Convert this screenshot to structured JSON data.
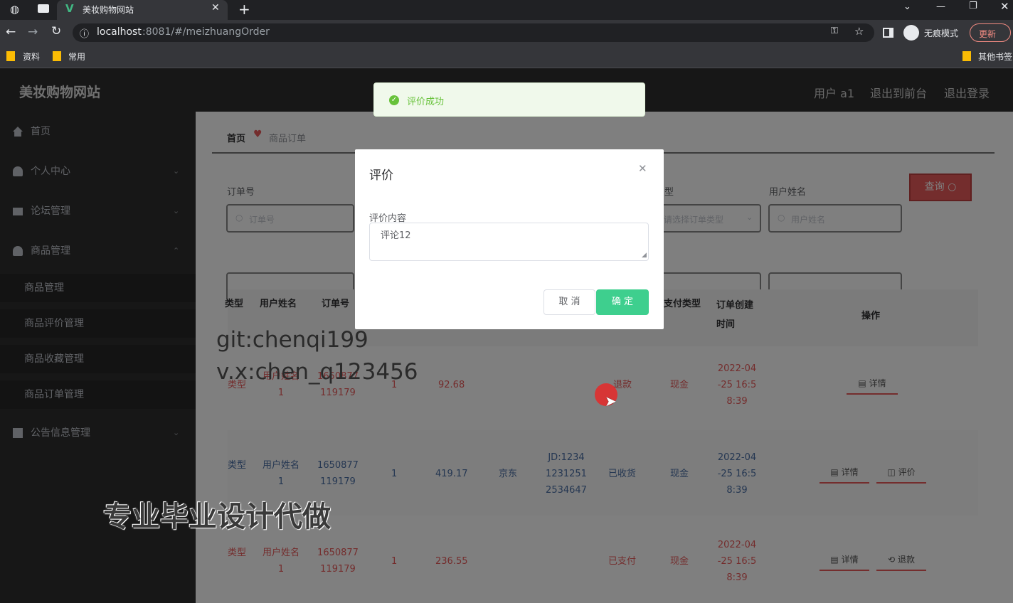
{
  "browser": {
    "tab_title": "美妆购物网站",
    "new_tab_symbol": "+",
    "url_host": "localhost",
    "url_rest": ":8081/#/meizhuangOrder",
    "incognito_label": "无痕模式",
    "update_label": "更新",
    "bookmarks": [
      "资料",
      "常用"
    ],
    "other_bookmarks": "其他书签"
  },
  "app": {
    "site_title": "美妆购物网站",
    "header_links": [
      "用户 a1",
      "退出到前台",
      "退出登录"
    ]
  },
  "sidebar": {
    "items": [
      {
        "label": "首页",
        "icon": "home-icon",
        "has_caret": false
      },
      {
        "label": "个人中心",
        "icon": "user-icon",
        "has_caret": true,
        "caret": "⌄"
      },
      {
        "label": "论坛管理",
        "icon": "briefcase-icon",
        "has_caret": true,
        "caret": "⌄"
      },
      {
        "label": "商品管理",
        "icon": "user-icon",
        "has_caret": true,
        "caret": "⌃"
      }
    ],
    "sub_items": [
      "商品管理",
      "商品评价管理",
      "商品收藏管理",
      "商品订单管理"
    ],
    "last_item": {
      "label": "公告信息管理",
      "icon": "notice-icon",
      "caret": "⌄"
    }
  },
  "breadcrumb": {
    "home": "首页",
    "current": "商品订单"
  },
  "search": {
    "order_no_label": "订单号",
    "order_no_placeholder": "订单号",
    "type_label": "型",
    "type_placeholder": "请选择订单类型",
    "username_label": "用户姓名",
    "username_placeholder": "用户姓名",
    "query_button": "查询"
  },
  "table": {
    "headers": [
      "类型",
      "用户姓名",
      "订单号",
      "支付类型",
      "订单创建时间",
      "操作"
    ],
    "rows": [
      {
        "type": "类型",
        "user": "用户姓名1",
        "user_a": "用户姓名",
        "user_b": "1",
        "order_a": "1650877",
        "order_b": "119179",
        "qty": "1",
        "price": "92.68",
        "status": "退款",
        "pay": "现金",
        "time_a": "2022-04",
        "time_b": "-25 16:5",
        "time_c": "8:39",
        "actions": [
          "详情"
        ]
      },
      {
        "type": "类型",
        "user_a": "用户姓名",
        "user_b": "1",
        "order_a": "1650877",
        "order_b": "119179",
        "qty": "1",
        "price": "419.17",
        "carrier": "京东",
        "track_a": "JD:1234",
        "track_b": "1231251",
        "track_c": "2534647",
        "status": "已收货",
        "pay": "现金",
        "time_a": "2022-04",
        "time_b": "-25 16:5",
        "time_c": "8:39",
        "actions": [
          "详情",
          "评价"
        ]
      },
      {
        "type": "类型",
        "user_a": "用户姓名",
        "user_b": "1",
        "order_a": "1650877",
        "order_b": "119179",
        "qty": "1",
        "price": "236.55",
        "status": "已支付",
        "pay": "现金",
        "time_a": "2022-04",
        "time_b": "-25 16:5",
        "time_c": "8:39",
        "actions": [
          "详情",
          "退款"
        ]
      }
    ]
  },
  "dialog": {
    "title": "评价",
    "field_label": "评价内容",
    "field_value": "评论12",
    "cancel": "取 消",
    "confirm": "确 定"
  },
  "toast": {
    "message": "评价成功"
  },
  "watermarks": {
    "line1": "git:chenqi199",
    "line2": "v.x:chen_q123456",
    "line3": "专业毕业设计代做"
  },
  "colors": {
    "sidebar_bg": "#2f2f2f",
    "accent_red": "#e85a5a",
    "confirm_green": "#3ecf8e",
    "toast_bg": "#f0f9eb"
  }
}
